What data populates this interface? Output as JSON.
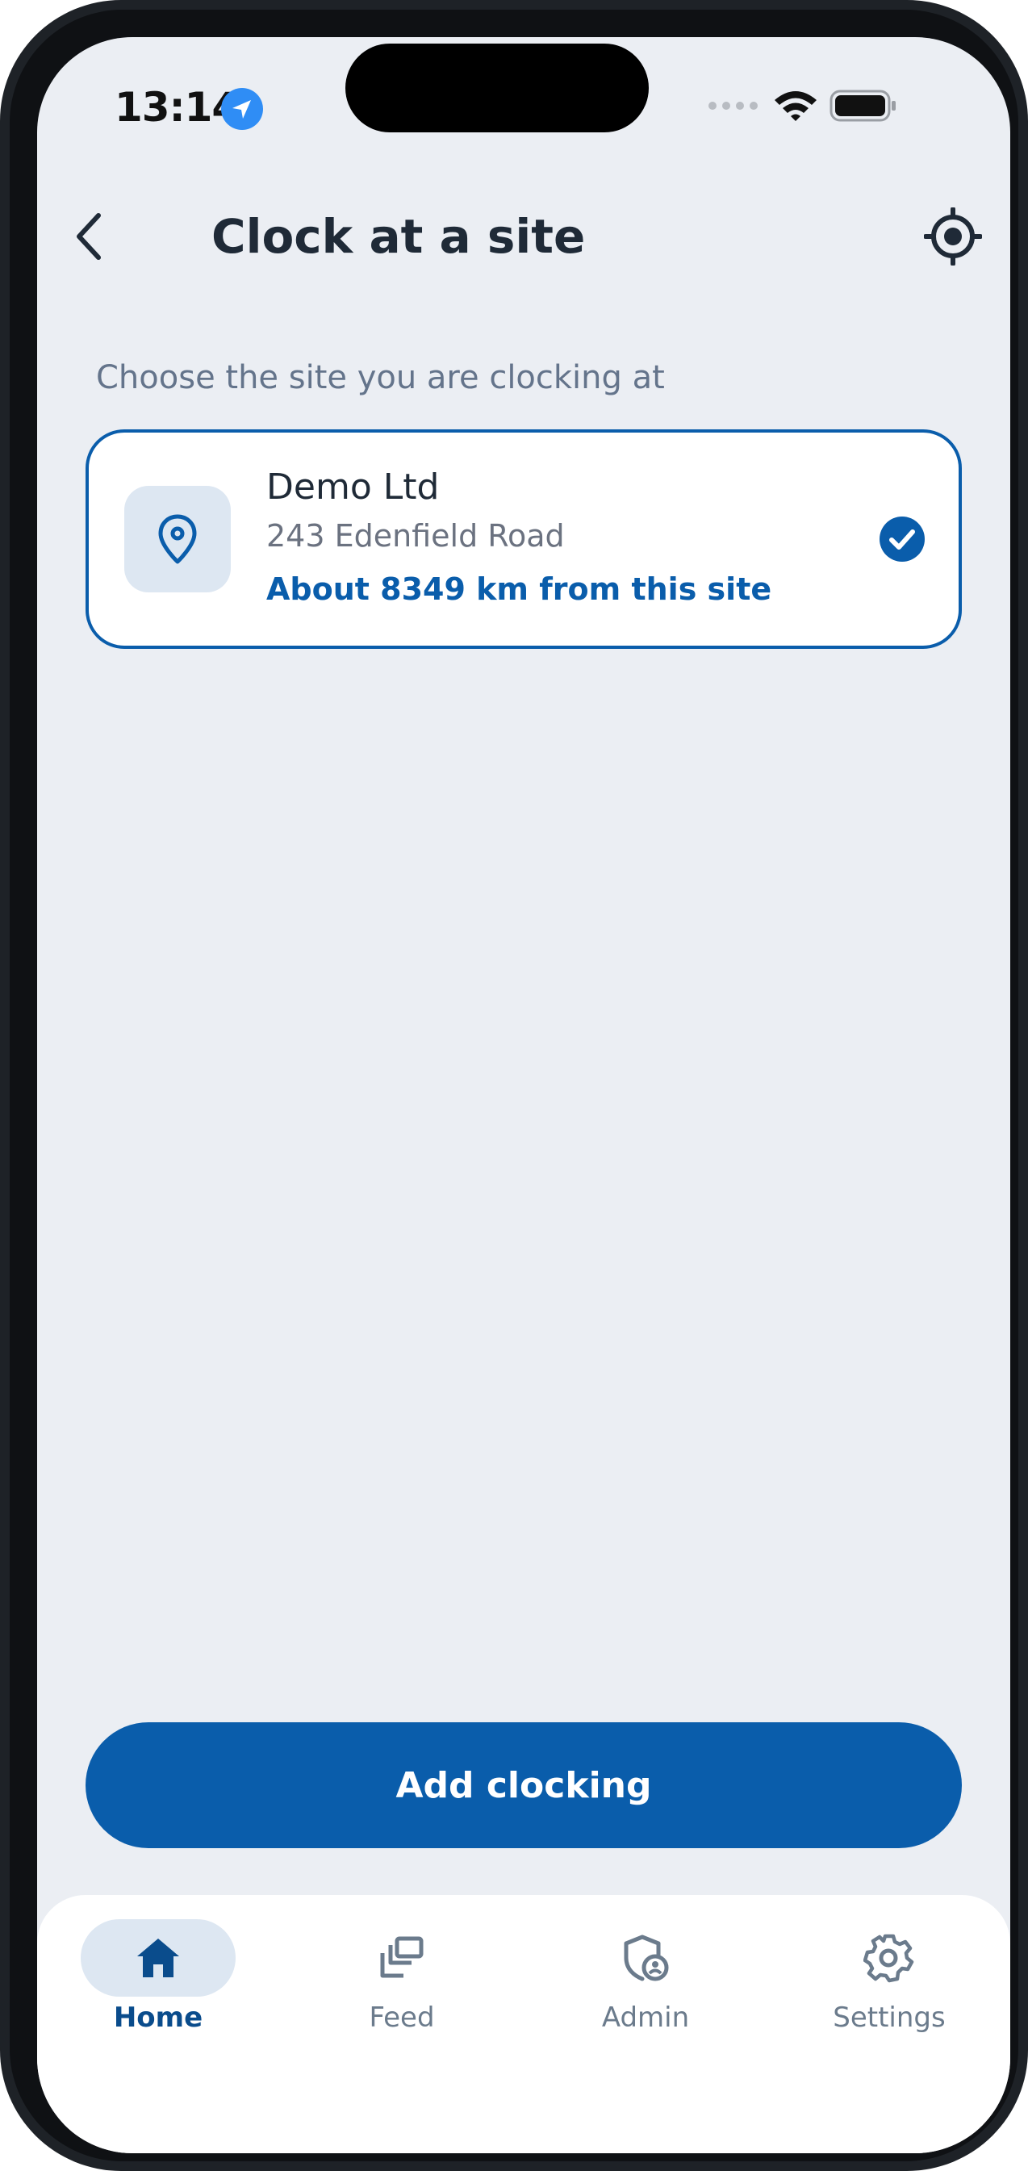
{
  "status_bar": {
    "time": "13:14"
  },
  "header": {
    "title": "Clock at a site"
  },
  "instruction": "Choose the site you are clocking at",
  "sites": [
    {
      "name": "Demo Ltd",
      "address": "243 Edenfield Road",
      "distance": "About 8349 km from this site",
      "selected": true
    }
  ],
  "primary_action": {
    "label": "Add clocking"
  },
  "bottom_nav": {
    "items": [
      {
        "label": "Home",
        "icon": "home-icon",
        "active": true
      },
      {
        "label": "Feed",
        "icon": "feed-icon",
        "active": false
      },
      {
        "label": "Admin",
        "icon": "admin-shield-icon",
        "active": false
      },
      {
        "label": "Settings",
        "icon": "gear-icon",
        "active": false
      }
    ]
  },
  "colors": {
    "accent": "#0a5dab",
    "background": "#ebeef3",
    "title_text": "#1f2a37",
    "muted_text": "#64748b",
    "active_nav_bg": "#dde7f2"
  }
}
